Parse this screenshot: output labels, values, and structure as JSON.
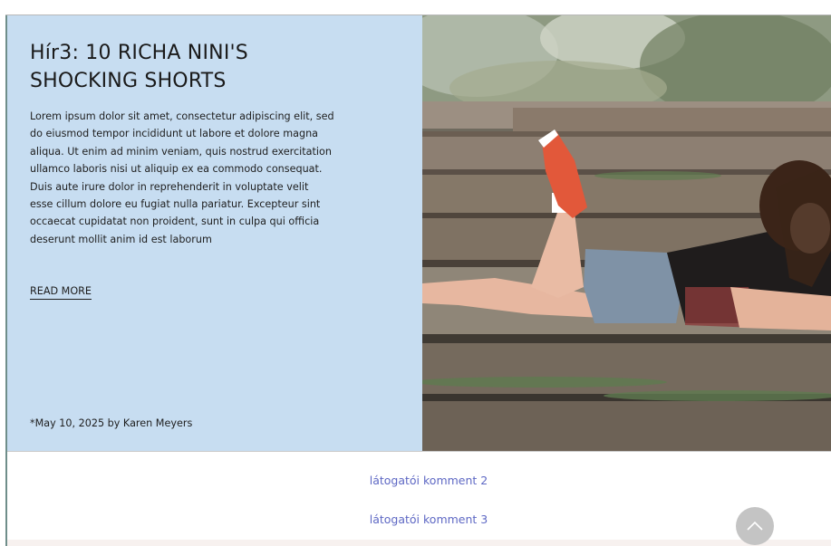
{
  "article": {
    "title": "Hír3: 10 RICHA NINI'S\nSHOCKING SHORTS",
    "body": "Lorem ipsum dolor sit amet, consectetur adipiscing elit, sed do eiusmod tempor incididunt ut labore et dolore magna aliqua. Ut enim ad minim veniam, quis nostrud exercitation ullamco laboris nisi ut aliquip ex ea commodo consequat. Duis aute irure dolor in reprehenderit in voluptate velit esse cillum dolore eu fugiat nulla pariatur. Excepteur sint occaecat cupidatat non proident, sunt in culpa qui officia deserunt mollit anim id est laborum",
    "read_more_label": "READ MORE",
    "byline": "*May 10, 2025 by Karen Meyers"
  },
  "comments": [
    {
      "label": "látogatói komment 2"
    },
    {
      "label": "látogatói komment 3"
    }
  ],
  "icons": {
    "scroll_top": "chevron-up-icon"
  },
  "colors": {
    "article_panel_bg": "#c7ddf1",
    "comment_link": "#5e68c4",
    "scroll_button_bg": "#c4c4c4"
  }
}
